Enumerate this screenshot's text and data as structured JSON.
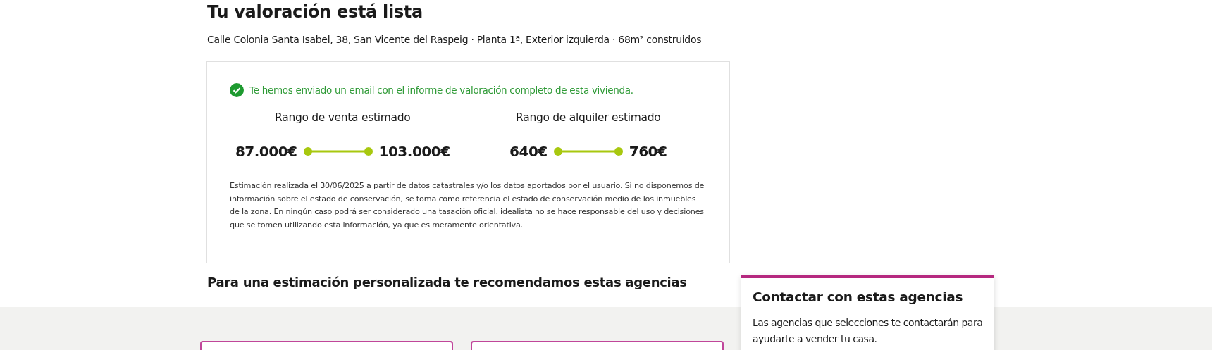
{
  "title": "Tu valoración está lista",
  "address": "Calle Colonia Santa Isabel, 38, San Vicente del Raspeig · Planta 1ª, Exterior izquierda · 68m² construidos",
  "valuation": {
    "notice": "Te hemos enviado un email con el informe de valoración completo de esta vivienda.",
    "ranges": [
      {
        "label": "Rango de venta estimado",
        "min": "87.000€",
        "max": "103.000€"
      },
      {
        "label": "Rango de alquiler estimado",
        "min": "640€",
        "max": "760€"
      }
    ],
    "disclaimer": "Estimación realizada el 30/06/2025 a partir de datos catastrales y/o los datos aportados por el usuario. Si no disponemos de información sobre el estado de conservación, se toma como referencia el estado de conservación medio de los inmuebles de la zona. En ningún caso podrá ser considerado una tasación oficial. idealista no se hace responsable del uso y decisiones que se tomen utilizando esta información, ya que es meramente orientativa."
  },
  "agencies": {
    "heading": "Para una estimación personalizada te recomendamos estas agencias"
  },
  "contact_panel": {
    "title": "Contactar con estas agencias",
    "text": "Las agencias que selecciones te contactarán para ayudarte a vender tu casa."
  }
}
